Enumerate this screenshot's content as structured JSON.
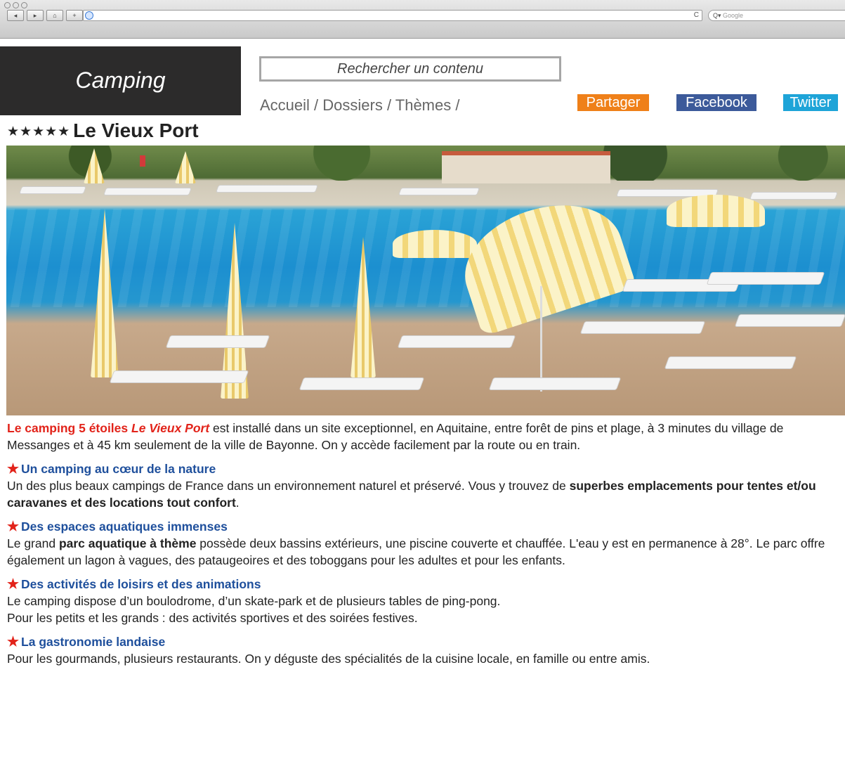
{
  "browser": {
    "search_placeholder": "Google",
    "reload_glyph": "C",
    "search_glyph": "Q▾"
  },
  "site": {
    "logo": "Camping",
    "search_placeholder": "Rechercher un contenu",
    "breadcrumb": "Accueil / Dossiers / Thèmes /",
    "share": {
      "partager": "Partager",
      "facebook": "Facebook",
      "twitter": "Twitter"
    },
    "colors": {
      "partager": "#ef8019",
      "facebook": "#3c5a9a",
      "twitter": "#1ea4d8",
      "accent_red": "#e2231a",
      "heading_blue": "#1e4f9c",
      "logo_bg": "#2c2b2b"
    }
  },
  "page": {
    "stars": "★★★★★",
    "title": "Le Vieux Port",
    "photo_icon": "pool-photo"
  },
  "article": {
    "lead": {
      "red_start": "Le camping 5 étoiles ",
      "red_italic": "Le Vieux Port",
      "rest": " est installé dans un site exceptionnel, en Aquitaine, entre forêt de pins et plage, à 3 minutes du village de Messanges et à 45 km seulement de la ville de Bayonne. On y accède facilement par la route ou en train."
    },
    "sections": [
      {
        "heading": "Un camping au cœur de la nature",
        "text_1": "Un des plus beaux campings de France dans un environnement naturel et préservé. Vous y trouvez de ",
        "bold": "superbes emplacements pour tentes et/ou caravanes et des locations tout confort",
        "text_2": "."
      },
      {
        "heading": "Des espaces aquatiques immenses",
        "text_1": "Le grand ",
        "bold": "parc aquatique à thème",
        "text_2": " possède deux bassins extérieurs, une piscine couverte et chauffée. L'eau y est en permanence à 28°. Le parc offre également un lagon à vagues, des pataugeoires et des toboggans pour les adultes et pour les enfants."
      },
      {
        "heading": "Des activités de loisirs et des animations",
        "line_1": "Le camping dispose d’un boulodrome, d’un skate-park et de plusieurs tables de ping-pong.",
        "line_2": "Pour les petits et les grands : des activités sportives et des soirées festives."
      },
      {
        "heading": "La gastronomie landaise",
        "text": "Pour les gourmands, plusieurs restaurants. On y déguste des spécialités de la cuisine locale, en famille ou entre amis."
      }
    ]
  }
}
